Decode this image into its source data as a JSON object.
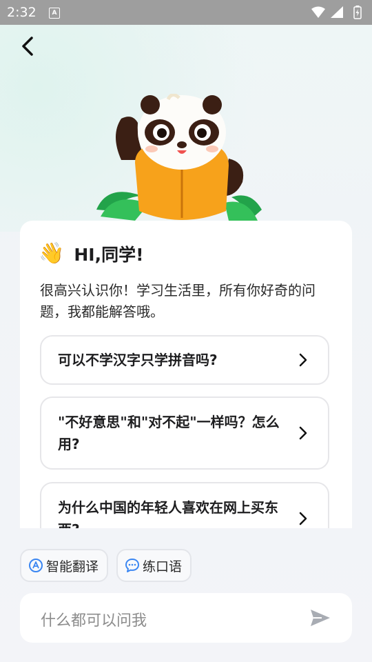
{
  "status_bar": {
    "time": "2:32",
    "notification_glyph": "A"
  },
  "greeting": {
    "emoji": "👋",
    "title": "HI,同学!"
  },
  "intro_text": "很高兴认识你！学习生活里，所有你好奇的问题，我都能解答哦。",
  "questions": [
    {
      "text": "可以不学汉字只学拼音吗?"
    },
    {
      "text": "\"不好意思\"和\"对不起\"一样吗？怎么用?"
    },
    {
      "text": "为什么中国的年轻人喜欢在网上买东西?"
    }
  ],
  "chips": [
    {
      "label": "智能翻译",
      "icon": "translate-icon"
    },
    {
      "label": "练口语",
      "icon": "chat-bubble-icon"
    }
  ],
  "input": {
    "placeholder": "什么都可以问我"
  },
  "colors": {
    "accent_blue": "#3a86f2",
    "mascot_orange": "#f7a21b",
    "status_bar": "#9e9e9e",
    "send_icon": "#a8acb3"
  }
}
